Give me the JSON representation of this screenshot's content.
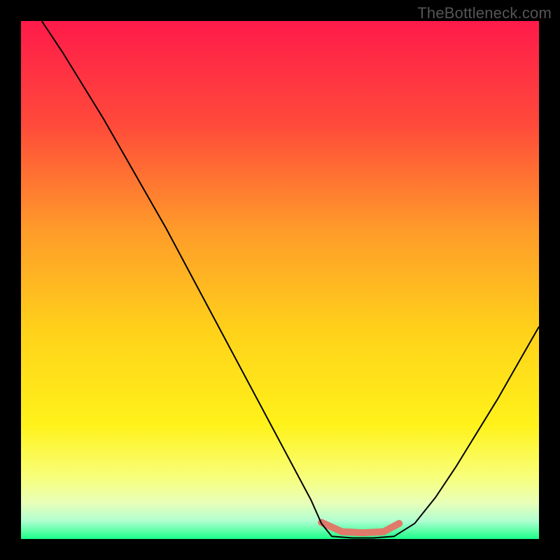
{
  "watermark": "TheBottleneck.com",
  "chart_data": {
    "type": "line",
    "title": "",
    "xlabel": "",
    "ylabel": "",
    "xlim": [
      0,
      100
    ],
    "ylim": [
      0,
      100
    ],
    "gradient_stops": [
      {
        "offset": 0.0,
        "color": "#ff1a4a"
      },
      {
        "offset": 0.2,
        "color": "#ff4a3a"
      },
      {
        "offset": 0.4,
        "color": "#ff9a2a"
      },
      {
        "offset": 0.6,
        "color": "#ffd21a"
      },
      {
        "offset": 0.78,
        "color": "#fff21a"
      },
      {
        "offset": 0.88,
        "color": "#f8ff7a"
      },
      {
        "offset": 0.93,
        "color": "#e8ffb8"
      },
      {
        "offset": 0.965,
        "color": "#b0ffd0"
      },
      {
        "offset": 1.0,
        "color": "#1aff88"
      }
    ],
    "series": [
      {
        "name": "bottleneck-curve",
        "color": "#000000",
        "width": 2,
        "x": [
          4,
          8,
          12,
          16,
          20,
          24,
          28,
          32,
          36,
          40,
          44,
          48,
          52,
          56,
          58,
          60,
          64,
          68,
          72,
          76,
          80,
          84,
          88,
          92,
          96,
          100
        ],
        "y": [
          100,
          94,
          87.5,
          81,
          74,
          67,
          60,
          52.5,
          45,
          37.5,
          30,
          22.5,
          15,
          7.5,
          3,
          0.5,
          0.2,
          0.2,
          0.5,
          3,
          8,
          14,
          20.5,
          27,
          34,
          41
        ]
      }
    ],
    "optimal_band": {
      "color": "#e07a6a",
      "width": 10,
      "x": [
        58,
        62,
        66,
        70,
        73
      ],
      "y": [
        3.2,
        1.4,
        1.2,
        1.4,
        3.0
      ]
    }
  }
}
